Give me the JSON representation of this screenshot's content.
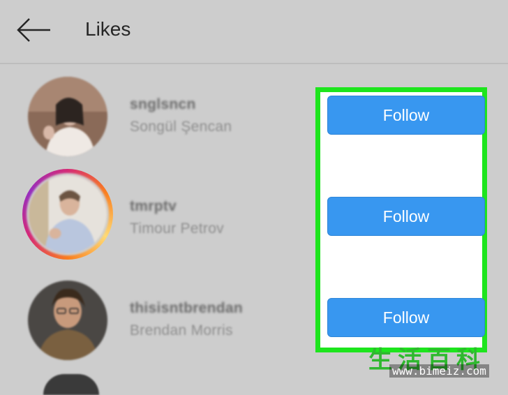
{
  "header": {
    "back_icon": "back-arrow-icon",
    "title": "Likes"
  },
  "users": [
    {
      "username": "snglsncn",
      "full_name": "Songül Şencan",
      "follow_label": "Follow",
      "has_story": false
    },
    {
      "username": "tmrptv",
      "full_name": "Timour Petrov",
      "follow_label": "Follow",
      "has_story": true
    },
    {
      "username": "thisisntbrendan",
      "full_name": "Brendan Morris",
      "follow_label": "Follow",
      "has_story": false
    }
  ],
  "colors": {
    "follow_button": "#3897f0",
    "highlight_border": "#1de51d",
    "background": "#cdcdcd"
  },
  "watermark": {
    "chars": "生活百科",
    "url": "www.bimeiz.com"
  }
}
